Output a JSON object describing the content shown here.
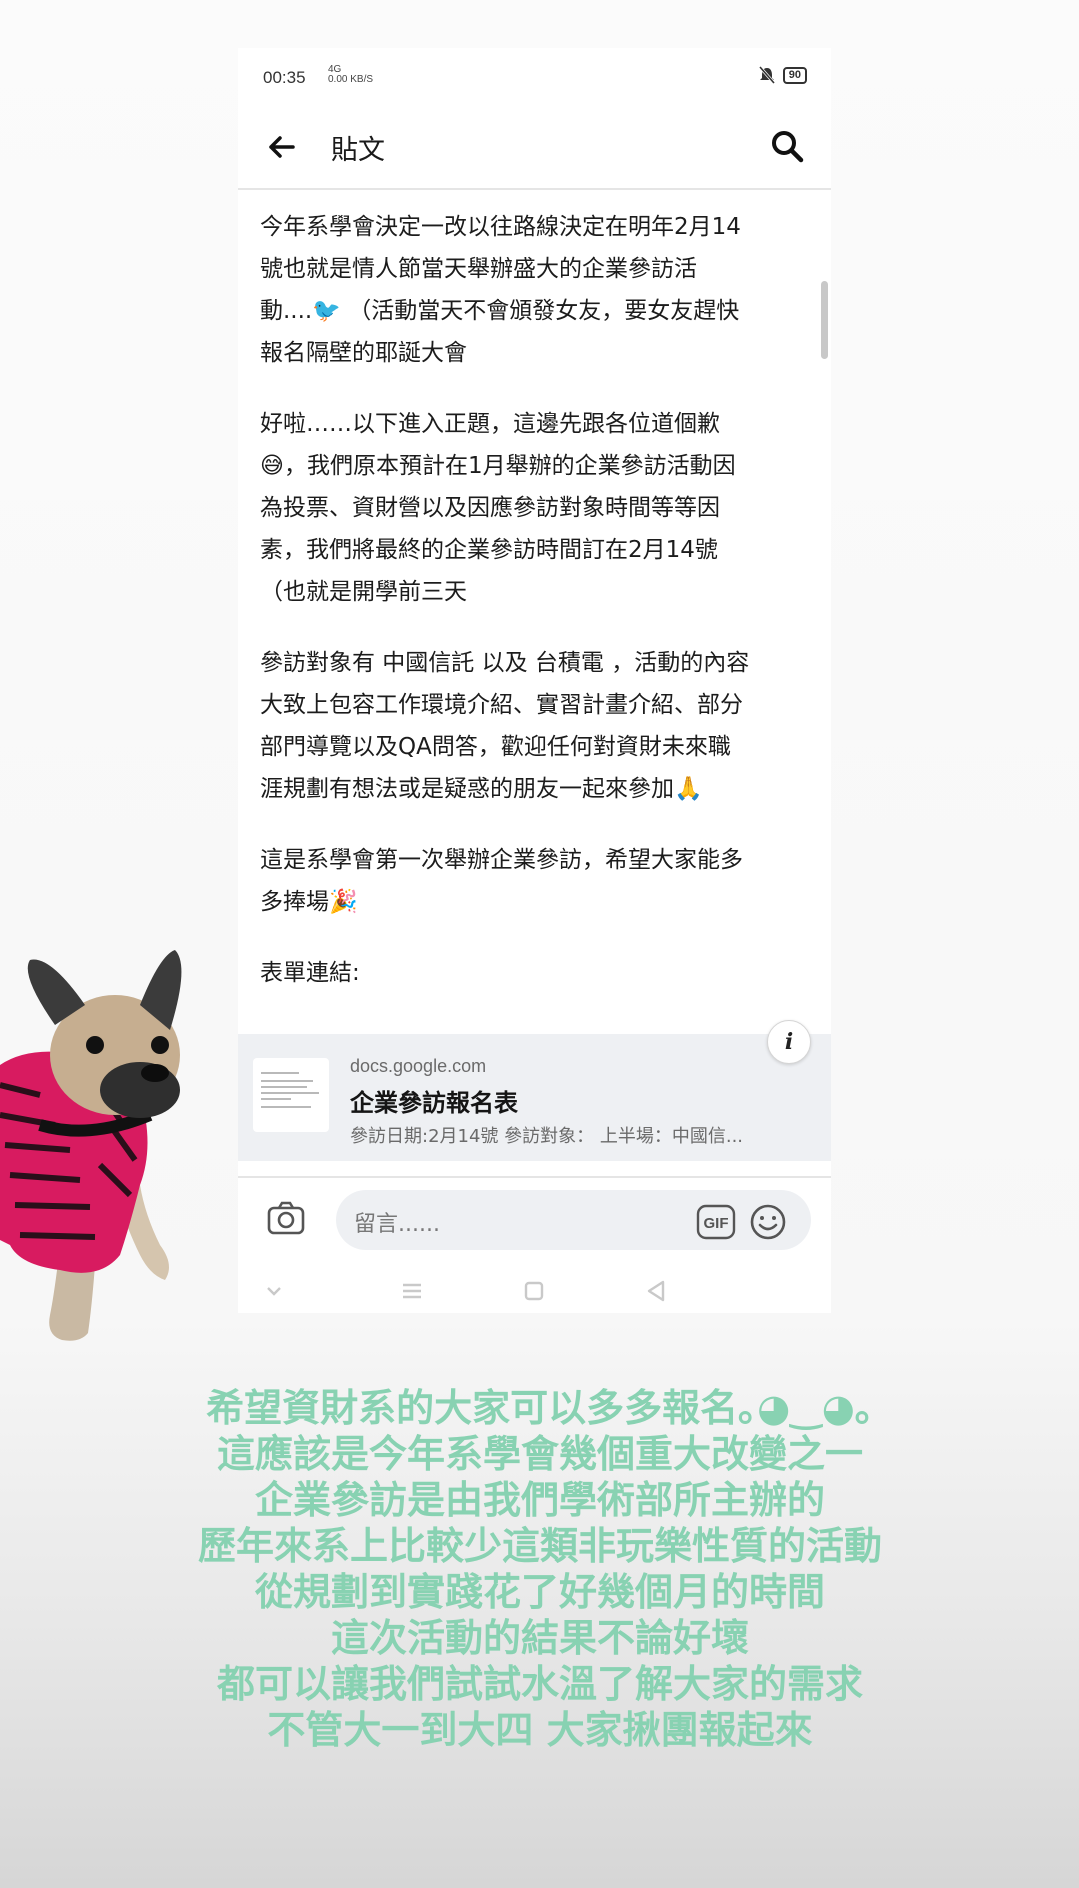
{
  "status_bar": {
    "time": "00:35",
    "signal": "4G",
    "network_speed": "0.00 KB/S",
    "battery": "90"
  },
  "app_bar": {
    "title": "貼文"
  },
  "post": {
    "paragraphs": [
      [
        "今年系學會決定一改以往路線決定在明年2月14",
        "號也就是情人節當天舉辦盛大的企業參訪活",
        "動....🐦 （活動當天不會頒發女友，要女友趕快",
        "報名隔壁的耶誕大會"
      ],
      [
        "好啦……以下進入正題，這邊先跟各位道個歉",
        "😅，我們原本預計在1月舉辦的企業參訪活動因",
        "為投票、資財營以及因應參訪對象時間等等因",
        "素，我們將最終的企業參訪時間訂在2月14號",
        "（也就是開學前三天"
      ],
      [
        "參訪對象有 中國信託 以及 台積電 ，活動的內容",
        "大致上包容工作環境介紹、實習計畫介紹、部分",
        "部門導覽以及QA問答，歡迎任何對資財未來職",
        "涯規劃有想法或是疑惑的朋友一起來參加🙏"
      ],
      [
        "這是系學會第一次舉辦企業參訪，希望大家能多",
        "多捧場🎉"
      ],
      [
        "表單連結:"
      ]
    ]
  },
  "link_card": {
    "domain": "docs.google.com",
    "title": "企業參訪報名表",
    "description": "參訪日期:2月14號 參訪對象： 上半場：中國信..."
  },
  "composer": {
    "placeholder": "留言......",
    "gif_label": "GIF"
  },
  "caption_lines": [
    "希望資財系的大家可以多多報名｡◕‿◕｡",
    "這應該是今年系學會幾個重大改變之一",
    "企業參訪是由我們學術部所主辦的",
    "歷年來系上比較少這類非玩樂性質的活動",
    "從規劃到實踐花了好幾個月的時間",
    "這次活動的結果不論好壞",
    "都可以讓我們試試水溫了解大家的需求",
    "不管大一到大四 大家揪團報起來"
  ],
  "colors": {
    "caption": "#88d2b2",
    "card_bg": "#eef0f3",
    "sweater": "#d81b60"
  }
}
